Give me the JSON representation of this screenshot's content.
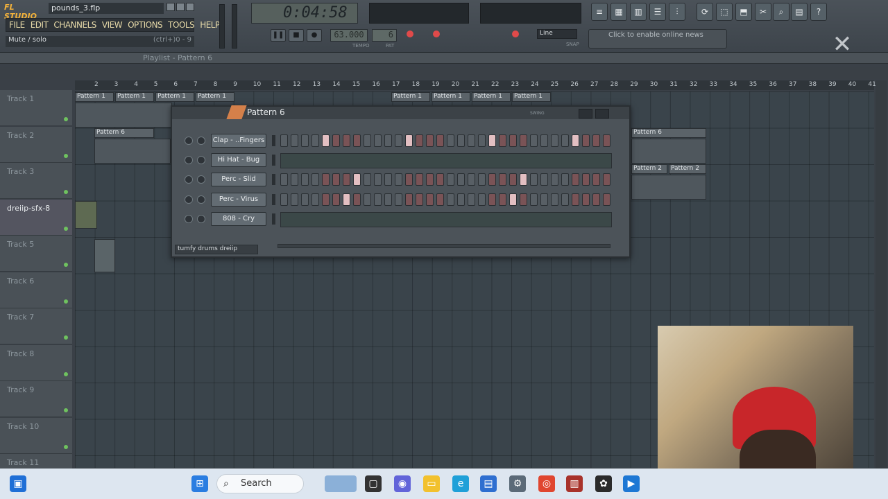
{
  "app": {
    "logo": "FL STUDIO",
    "filename": "pounds_3.flp"
  },
  "menu": [
    "FILE",
    "EDIT",
    "CHANNELS",
    "VIEW",
    "OPTIONS",
    "TOOLS",
    "HELP"
  ],
  "hint": {
    "text": "Mute / solo",
    "shortcut": "(ctrl+)0 - 9"
  },
  "transport": {
    "time": "0:04:58",
    "tempo": "63.000",
    "tempo_label": "TEMPO",
    "pattern_number": "6",
    "pattern_label": "PAT",
    "snap": "Line",
    "snap_label": "SNAP"
  },
  "news": "Click to enable online news",
  "playlist": {
    "title": "Playlist - Pattern 6",
    "ruler": [
      "2",
      "3",
      "4",
      "5",
      "6",
      "7",
      "8",
      "9",
      "10",
      "11",
      "12",
      "13",
      "14",
      "15",
      "16",
      "17",
      "18",
      "19",
      "20",
      "21",
      "22",
      "23",
      "24",
      "25",
      "26",
      "27",
      "28",
      "29",
      "30",
      "31",
      "32",
      "33",
      "34",
      "35",
      "36",
      "37",
      "38",
      "39",
      "40",
      "41"
    ],
    "tracks": [
      "Track 1",
      "Track 2",
      "Track 3",
      "dreiip-sfx-8",
      "Track 5",
      "Track 6",
      "Track 7",
      "Track 8",
      "Track 9",
      "Track 10",
      "Track 11"
    ],
    "clip_label": "Pattern 1",
    "clip_pattern6": "Pattern 6",
    "clip_pattern2": "Pattern 2"
  },
  "sequencer": {
    "title": "Pattern 6",
    "swing_label": "SWING",
    "channels": [
      "Clap - ..Fingers",
      "Hi Hat - Bug",
      "Perc - Slid",
      "Perc - Virus",
      "808 - Cry"
    ],
    "footer": "tumfy drums dreiip"
  },
  "taskbar": {
    "search": "Search"
  },
  "colors": {
    "accent": "#f3b23a",
    "step_on": "#e3bfc2",
    "led": "#6fc25f"
  }
}
